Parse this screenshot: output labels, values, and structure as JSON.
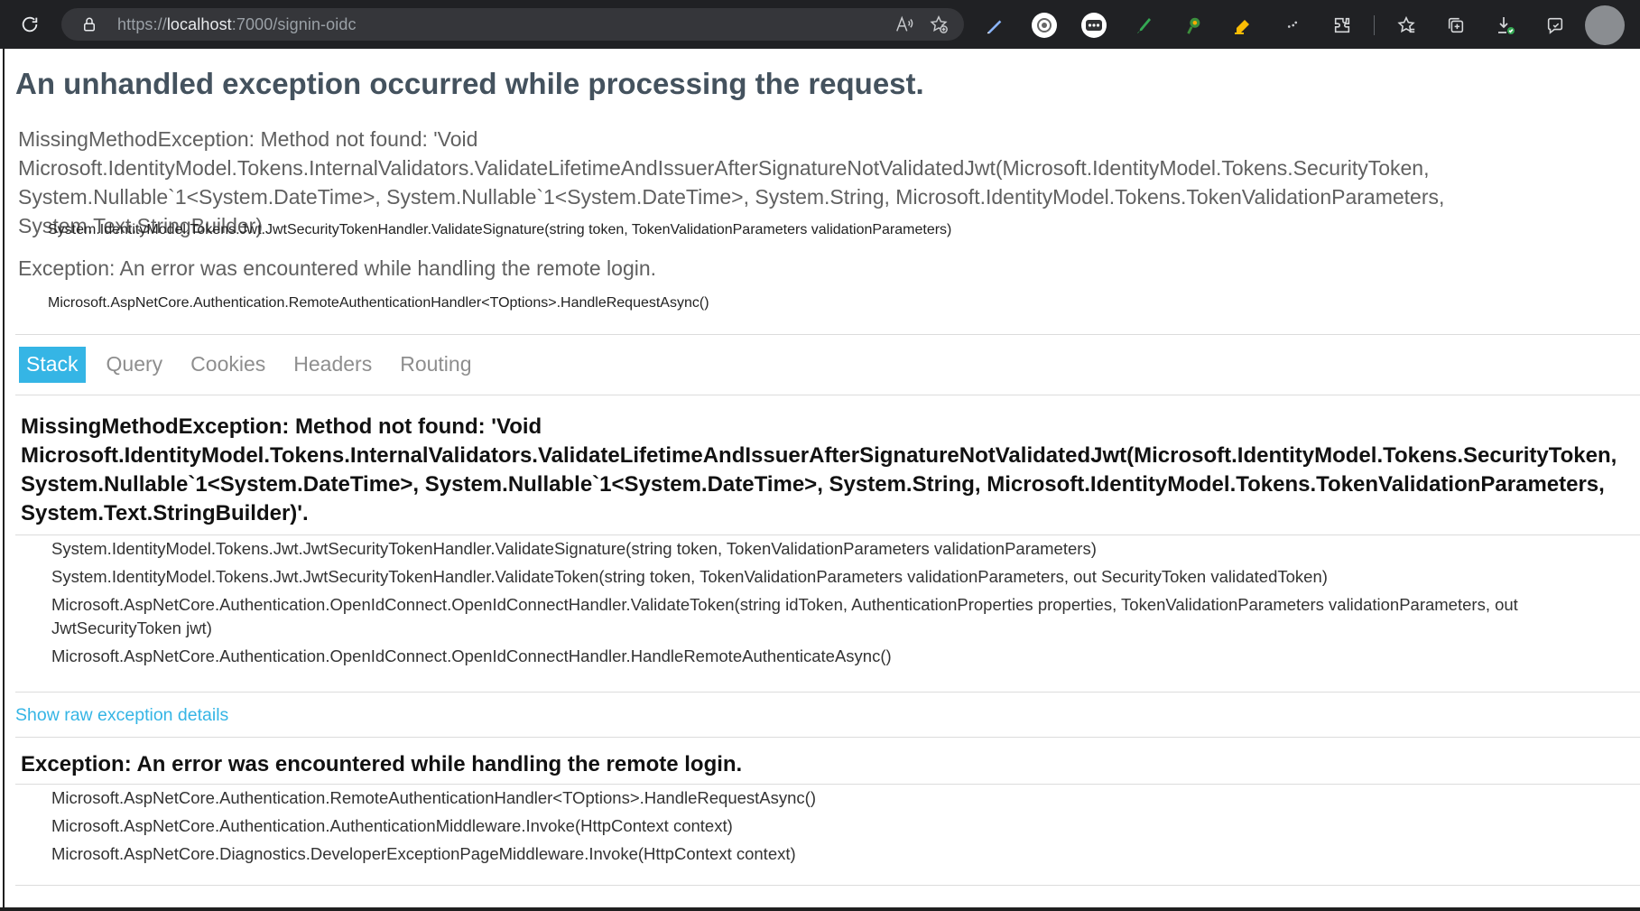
{
  "browser": {
    "url_scheme": "https://",
    "url_host": "localhost",
    "url_rest": ":7000/signin-oidc",
    "icons": [
      "refresh-icon",
      "lock-icon",
      "read-aloud-icon",
      "add-favorite-icon",
      "pen-extension-icon",
      "openai-extension-icon",
      "chat-extension-icon",
      "green-brush-extension-icon",
      "puzzle-green-extension-icon",
      "highlighter-extension-icon",
      "dots-extension-icon",
      "extensions-icon",
      "favorites-icon",
      "collections-icon",
      "downloads-icon",
      "feedback-icon",
      "profile-avatar"
    ]
  },
  "page": {
    "title": "An unhandled exception occurred while processing the request.",
    "summary_1": "MissingMethodException: Method not found: 'Void Microsoft.IdentityModel.Tokens.InternalValidators.ValidateLifetimeAndIssuerAfterSignatureNotValidatedJwt(Microsoft.IdentityModel.Tokens.SecurityToken, System.Nullable`1<System.DateTime>, System.Nullable`1<System.DateTime>, System.String, Microsoft.IdentityModel.Tokens.TokenValidationParameters, System.Text.StringBuilder)",
    "summary_1_location": "System.IdentityModel.Tokens.Jwt.JwtSecurityTokenHandler.ValidateSignature(string token, TokenValidationParameters validationParameters)",
    "summary_2": "Exception: An error was encountered while handling the remote login.",
    "summary_2_location": "Microsoft.AspNetCore.Authentication.RemoteAuthenticationHandler<TOptions>.HandleRequestAsync()",
    "tabs": [
      {
        "label": "Stack",
        "active": true
      },
      {
        "label": "Query",
        "active": false
      },
      {
        "label": "Cookies",
        "active": false
      },
      {
        "label": "Headers",
        "active": false
      },
      {
        "label": "Routing",
        "active": false
      }
    ],
    "stack_1": {
      "title": "MissingMethodException: Method not found: 'Void Microsoft.IdentityModel.Tokens.InternalValidators.ValidateLifetimeAndIssuerAfterSignatureNotValidatedJwt(Microsoft.IdentityModel.Tokens.SecurityToken, System.Nullable`1<System.DateTime>, System.Nullable`1<System.DateTime>, System.String, Microsoft.IdentityModel.Tokens.TokenValidationParameters, System.Text.StringBuilder)'.",
      "frames": [
        "System.IdentityModel.Tokens.Jwt.JwtSecurityTokenHandler.ValidateSignature(string token, TokenValidationParameters validationParameters)",
        "System.IdentityModel.Tokens.Jwt.JwtSecurityTokenHandler.ValidateToken(string token, TokenValidationParameters validationParameters, out SecurityToken validatedToken)",
        "Microsoft.AspNetCore.Authentication.OpenIdConnect.OpenIdConnectHandler.ValidateToken(string idToken, AuthenticationProperties properties, TokenValidationParameters validationParameters, out JwtSecurityToken jwt)",
        "Microsoft.AspNetCore.Authentication.OpenIdConnect.OpenIdConnectHandler.HandleRemoteAuthenticateAsync()"
      ]
    },
    "raw_link": "Show raw exception details",
    "stack_2": {
      "title": "Exception: An error was encountered while handling the remote login.",
      "frames": [
        "Microsoft.AspNetCore.Authentication.RemoteAuthenticationHandler<TOptions>.HandleRequestAsync()",
        "Microsoft.AspNetCore.Authentication.AuthenticationMiddleware.Invoke(HttpContext context)",
        "Microsoft.AspNetCore.Diagnostics.DeveloperExceptionPageMiddleware.Invoke(HttpContext context)"
      ]
    }
  },
  "colors": {
    "chrome_bg": "#202124",
    "address_bg": "#35363a",
    "title": "#44525e",
    "accent": "#35b5e5",
    "muted_text": "#606060"
  }
}
